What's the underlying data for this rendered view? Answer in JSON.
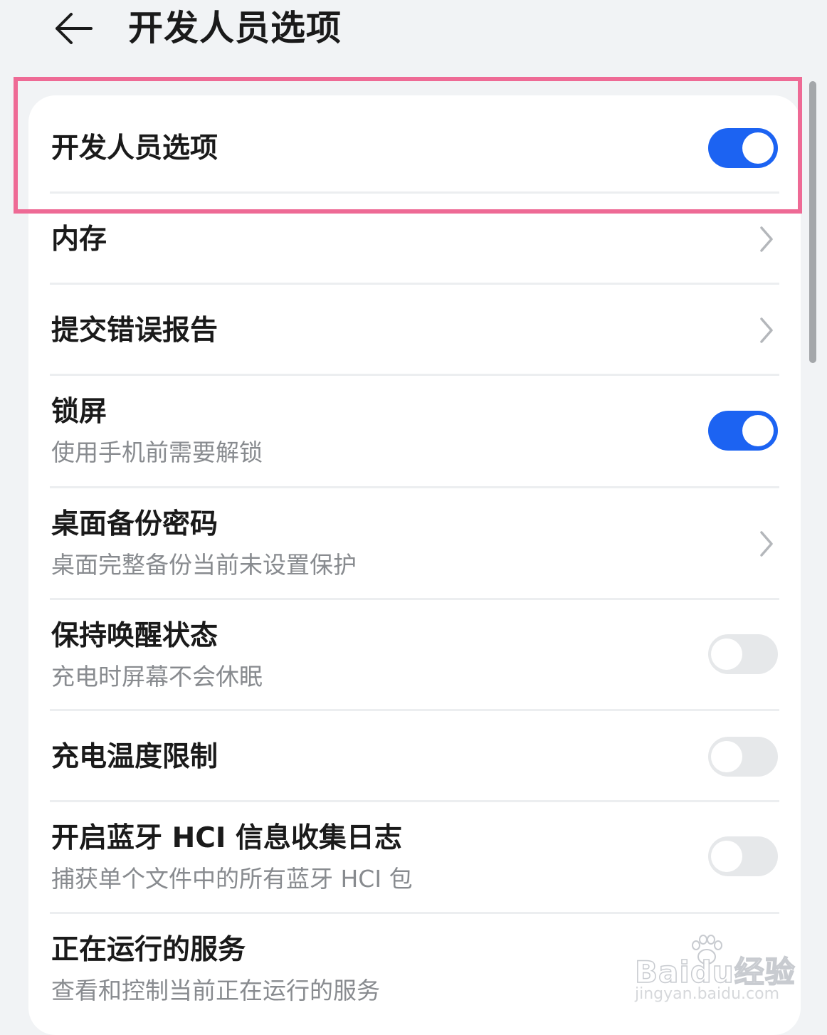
{
  "header": {
    "title": "开发人员选项"
  },
  "rows": [
    {
      "title": "开发人员选项",
      "toggle": "on"
    },
    {
      "title": "内存",
      "action": "chevron"
    },
    {
      "title": "提交错误报告",
      "action": "chevron"
    },
    {
      "title": "锁屏",
      "subtitle": "使用手机前需要解锁",
      "toggle": "on"
    },
    {
      "title": "桌面备份密码",
      "subtitle": "桌面完整备份当前未设置保护",
      "action": "chevron"
    },
    {
      "title": "保持唤醒状态",
      "subtitle": "充电时屏幕不会休眠",
      "toggle": "off"
    },
    {
      "title": "充电温度限制",
      "toggle": "off"
    },
    {
      "title": "开启蓝牙 HCI 信息收集日志",
      "subtitle": "捕获单个文件中的所有蓝牙 HCI 包",
      "toggle": "off"
    },
    {
      "title": "正在运行的服务",
      "subtitle": "查看和控制当前正在运行的服务"
    }
  ],
  "watermark": {
    "brand": "Baidu经验",
    "url": "jingyan.baidu.com"
  },
  "colors": {
    "toggle_on": "#1c63f2",
    "toggle_off": "#e6e8ea",
    "highlight_border": "#ee6a95",
    "background": "#f1f3f5",
    "subtitle_text": "#888b8f"
  },
  "icons": {
    "back": "arrow-left-icon",
    "chevron": "chevron-right-icon"
  }
}
